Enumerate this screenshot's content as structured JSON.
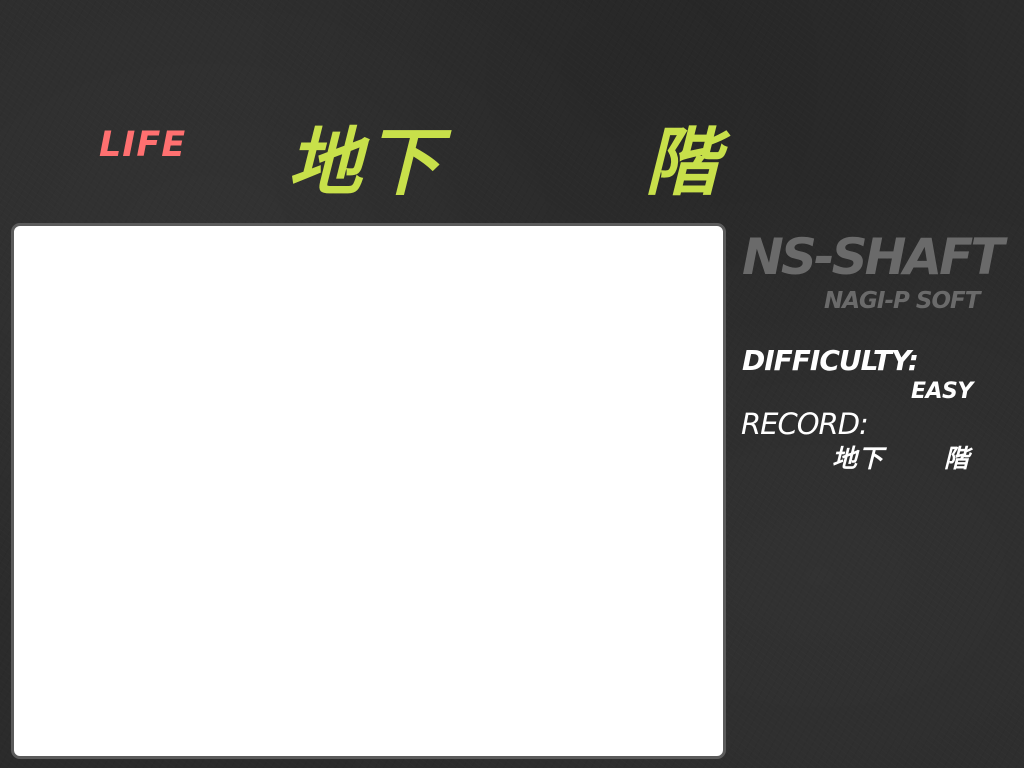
{
  "hud": {
    "life_label": "LIFE",
    "floor_prefix": "地下",
    "floor_value": "",
    "floor_suffix": "階"
  },
  "sidebar": {
    "title": "NS-SHAFT",
    "subtitle": "NAGI-P SOFT",
    "difficulty_label": "DIFFICULTY:",
    "difficulty_value": "EASY",
    "record_label": "RECORD:",
    "record_prefix": "地下",
    "record_value": "",
    "record_suffix": "階"
  },
  "colors": {
    "background": "#2b2b2b",
    "life": "#ff7070",
    "floor": "#c8e04a",
    "logo": "#6a6a6a",
    "info_text": "#ffffff",
    "playfield": "#ffffff",
    "playfield_border": "#5b5b5b"
  }
}
